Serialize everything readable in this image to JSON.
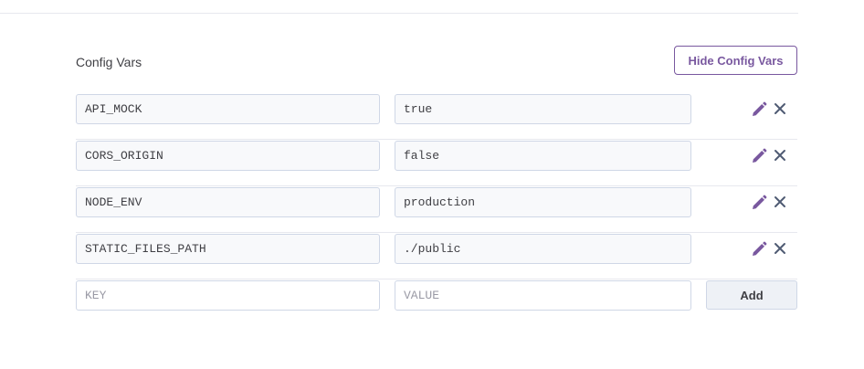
{
  "section": {
    "title": "Config Vars",
    "toggle_button": "Hide Config Vars"
  },
  "config_vars": [
    {
      "key": "API_MOCK",
      "value": "true"
    },
    {
      "key": "CORS_ORIGIN",
      "value": "false"
    },
    {
      "key": "NODE_ENV",
      "value": "production"
    },
    {
      "key": "STATIC_FILES_PATH",
      "value": "./public"
    }
  ],
  "new_var": {
    "key_placeholder": "KEY",
    "value_placeholder": "VALUE",
    "add_label": "Add"
  },
  "icons": {
    "edit": "pencil-icon",
    "delete": "close-icon"
  },
  "colors": {
    "accent": "#79589f",
    "icon_delete": "#4f5b73",
    "field_border": "#cfd7e6"
  }
}
